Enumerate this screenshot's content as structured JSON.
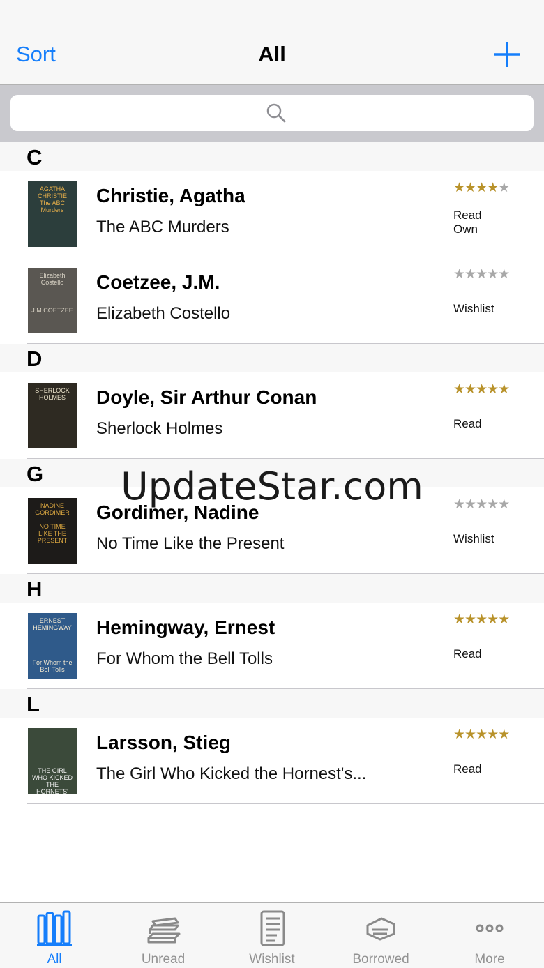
{
  "navbar": {
    "left_button": "Sort",
    "title": "All",
    "add_icon": "plus-icon"
  },
  "search": {
    "icon": "search-icon",
    "placeholder": ""
  },
  "sections": [
    {
      "letter": "C",
      "books": [
        {
          "author": "Christie, Agatha",
          "title": "The ABC Murders",
          "rating": 4,
          "status": [
            "Read",
            "Own"
          ],
          "cover": {
            "bg": "#2c3e3c",
            "fg": "#e9b04a",
            "text": "AGATHA\nCHRISTIE\nThe ABC Murders"
          }
        },
        {
          "author": "Coetzee, J.M.",
          "title": "Elizabeth Costello",
          "rating": 0,
          "status": [
            "Wishlist"
          ],
          "cover": {
            "bg": "#5a5752",
            "fg": "#d8d2c4",
            "text": "Elizabeth\nCostello\n\n\n\nJ.M.COETZEE"
          }
        }
      ]
    },
    {
      "letter": "D",
      "books": [
        {
          "author": "Doyle, Sir Arthur Conan",
          "title": "Sherlock Holmes",
          "rating": 5,
          "status": [
            "Read"
          ],
          "cover": {
            "bg": "#2e2a22",
            "fg": "#e8e0c8",
            "text": "SHERLOCK\nHOLMES"
          }
        }
      ]
    },
    {
      "letter": "G",
      "books": [
        {
          "author": "Gordimer, Nadine",
          "title": "No Time Like the Present",
          "rating": 0,
          "status": [
            "Wishlist"
          ],
          "cover": {
            "bg": "#1d1b19",
            "fg": "#d9a640",
            "text": "NADINE\nGORDIMER\n\nNO TIME\nLIKE THE\nPRESENT"
          }
        }
      ]
    },
    {
      "letter": "H",
      "books": [
        {
          "author": "Hemingway, Ernest",
          "title": "For Whom the Bell Tolls",
          "rating": 5,
          "status": [
            "Read"
          ],
          "cover": {
            "bg": "#2f5a8a",
            "fg": "#f2e8d0",
            "text": "ERNEST\nHEMINGWAY\n\n\n\n\nFor Whom the\nBell Tolls"
          }
        }
      ]
    },
    {
      "letter": "L",
      "books": [
        {
          "author": "Larsson, Stieg",
          "title": "The Girl Who Kicked the Hornest's...",
          "rating": 5,
          "status": [
            "Read"
          ],
          "cover": {
            "bg": "#3b4a3a",
            "fg": "#f0f0f0",
            "text": "\n\n\n\n\nTHE GIRL WHO KICKED\nTHE HORNETS' NEST\nSTIEG LARSSON"
          }
        }
      ]
    }
  ],
  "watermark": "UpdateStar.com",
  "colors": {
    "accent": "#157efb",
    "star_on": "#b8922a",
    "star_off": "#a8a8a8"
  },
  "tabs": [
    {
      "label": "All",
      "icon": "books-shelf-icon",
      "active": true
    },
    {
      "label": "Unread",
      "icon": "book-stack-icon",
      "active": false
    },
    {
      "label": "Wishlist",
      "icon": "checklist-icon",
      "active": false
    },
    {
      "label": "Borrowed",
      "icon": "hand-book-icon",
      "active": false
    },
    {
      "label": "More",
      "icon": "more-dots-icon",
      "active": false
    }
  ]
}
